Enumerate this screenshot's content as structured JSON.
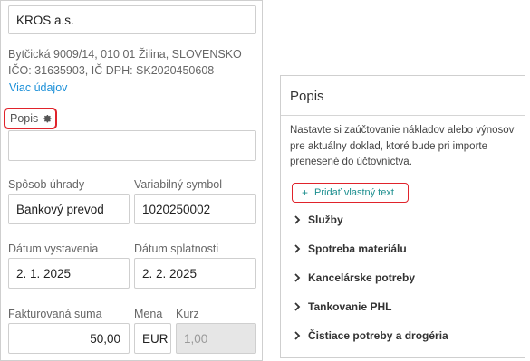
{
  "company": {
    "name": "KROS a.s.",
    "address_line1": "Bytčická 9009/14, 010 01 Žilina, SLOVENSKO",
    "address_line2": "IČO: 31635903, IČ DPH: SK2020450608",
    "more_link": "Viac údajov"
  },
  "popis_field": {
    "label": "Popis",
    "value": ""
  },
  "payment": {
    "method_label": "Spôsob úhrady",
    "method_value": "Bankový prevod",
    "vs_label": "Variabilný symbol",
    "vs_value": "1020250002"
  },
  "dates": {
    "issue_label": "Dátum vystavenia",
    "issue_value": "2. 1. 2025",
    "due_label": "Dátum splatnosti",
    "due_value": "2. 2. 2025"
  },
  "amount": {
    "sum_label": "Fakturovaná suma",
    "sum_value": "50,00",
    "currency_label": "Mena",
    "currency_value": "EUR",
    "rate_label": "Kurz",
    "rate_value": "1,00"
  },
  "panel": {
    "title": "Popis",
    "description": "Nastavte si zaúčtovanie nákladov alebo výnosov pre aktuálny doklad, ktoré bude pri importe prenesené do účtovníctva.",
    "add_label": "Pridať vlastný text",
    "categories": [
      "Služby",
      "Spotreba materiálu",
      "Kancelárske potreby",
      "Tankovanie PHL",
      "Čistiace potreby a drogéria"
    ]
  },
  "colors": {
    "highlight": "#e0232b",
    "link": "#1a8fd8",
    "accent": "#1d8f8f"
  },
  "icons": {
    "settings": "gear-icon",
    "add": "plus-icon",
    "expand": "chevron-right-icon"
  }
}
